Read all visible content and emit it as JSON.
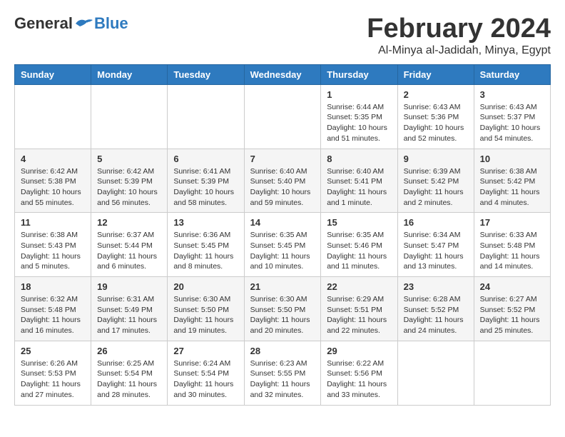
{
  "logo": {
    "general": "General",
    "blue": "Blue"
  },
  "header": {
    "month": "February 2024",
    "location": "Al-Minya al-Jadidah, Minya, Egypt"
  },
  "weekdays": [
    "Sunday",
    "Monday",
    "Tuesday",
    "Wednesday",
    "Thursday",
    "Friday",
    "Saturday"
  ],
  "weeks": [
    [
      {
        "day": "",
        "info": ""
      },
      {
        "day": "",
        "info": ""
      },
      {
        "day": "",
        "info": ""
      },
      {
        "day": "",
        "info": ""
      },
      {
        "day": "1",
        "info": "Sunrise: 6:44 AM\nSunset: 5:35 PM\nDaylight: 10 hours\nand 51 minutes."
      },
      {
        "day": "2",
        "info": "Sunrise: 6:43 AM\nSunset: 5:36 PM\nDaylight: 10 hours\nand 52 minutes."
      },
      {
        "day": "3",
        "info": "Sunrise: 6:43 AM\nSunset: 5:37 PM\nDaylight: 10 hours\nand 54 minutes."
      }
    ],
    [
      {
        "day": "4",
        "info": "Sunrise: 6:42 AM\nSunset: 5:38 PM\nDaylight: 10 hours\nand 55 minutes."
      },
      {
        "day": "5",
        "info": "Sunrise: 6:42 AM\nSunset: 5:39 PM\nDaylight: 10 hours\nand 56 minutes."
      },
      {
        "day": "6",
        "info": "Sunrise: 6:41 AM\nSunset: 5:39 PM\nDaylight: 10 hours\nand 58 minutes."
      },
      {
        "day": "7",
        "info": "Sunrise: 6:40 AM\nSunset: 5:40 PM\nDaylight: 10 hours\nand 59 minutes."
      },
      {
        "day": "8",
        "info": "Sunrise: 6:40 AM\nSunset: 5:41 PM\nDaylight: 11 hours\nand 1 minute."
      },
      {
        "day": "9",
        "info": "Sunrise: 6:39 AM\nSunset: 5:42 PM\nDaylight: 11 hours\nand 2 minutes."
      },
      {
        "day": "10",
        "info": "Sunrise: 6:38 AM\nSunset: 5:42 PM\nDaylight: 11 hours\nand 4 minutes."
      }
    ],
    [
      {
        "day": "11",
        "info": "Sunrise: 6:38 AM\nSunset: 5:43 PM\nDaylight: 11 hours\nand 5 minutes."
      },
      {
        "day": "12",
        "info": "Sunrise: 6:37 AM\nSunset: 5:44 PM\nDaylight: 11 hours\nand 6 minutes."
      },
      {
        "day": "13",
        "info": "Sunrise: 6:36 AM\nSunset: 5:45 PM\nDaylight: 11 hours\nand 8 minutes."
      },
      {
        "day": "14",
        "info": "Sunrise: 6:35 AM\nSunset: 5:45 PM\nDaylight: 11 hours\nand 10 minutes."
      },
      {
        "day": "15",
        "info": "Sunrise: 6:35 AM\nSunset: 5:46 PM\nDaylight: 11 hours\nand 11 minutes."
      },
      {
        "day": "16",
        "info": "Sunrise: 6:34 AM\nSunset: 5:47 PM\nDaylight: 11 hours\nand 13 minutes."
      },
      {
        "day": "17",
        "info": "Sunrise: 6:33 AM\nSunset: 5:48 PM\nDaylight: 11 hours\nand 14 minutes."
      }
    ],
    [
      {
        "day": "18",
        "info": "Sunrise: 6:32 AM\nSunset: 5:48 PM\nDaylight: 11 hours\nand 16 minutes."
      },
      {
        "day": "19",
        "info": "Sunrise: 6:31 AM\nSunset: 5:49 PM\nDaylight: 11 hours\nand 17 minutes."
      },
      {
        "day": "20",
        "info": "Sunrise: 6:30 AM\nSunset: 5:50 PM\nDaylight: 11 hours\nand 19 minutes."
      },
      {
        "day": "21",
        "info": "Sunrise: 6:30 AM\nSunset: 5:50 PM\nDaylight: 11 hours\nand 20 minutes."
      },
      {
        "day": "22",
        "info": "Sunrise: 6:29 AM\nSunset: 5:51 PM\nDaylight: 11 hours\nand 22 minutes."
      },
      {
        "day": "23",
        "info": "Sunrise: 6:28 AM\nSunset: 5:52 PM\nDaylight: 11 hours\nand 24 minutes."
      },
      {
        "day": "24",
        "info": "Sunrise: 6:27 AM\nSunset: 5:52 PM\nDaylight: 11 hours\nand 25 minutes."
      }
    ],
    [
      {
        "day": "25",
        "info": "Sunrise: 6:26 AM\nSunset: 5:53 PM\nDaylight: 11 hours\nand 27 minutes."
      },
      {
        "day": "26",
        "info": "Sunrise: 6:25 AM\nSunset: 5:54 PM\nDaylight: 11 hours\nand 28 minutes."
      },
      {
        "day": "27",
        "info": "Sunrise: 6:24 AM\nSunset: 5:54 PM\nDaylight: 11 hours\nand 30 minutes."
      },
      {
        "day": "28",
        "info": "Sunrise: 6:23 AM\nSunset: 5:55 PM\nDaylight: 11 hours\nand 32 minutes."
      },
      {
        "day": "29",
        "info": "Sunrise: 6:22 AM\nSunset: 5:56 PM\nDaylight: 11 hours\nand 33 minutes."
      },
      {
        "day": "",
        "info": ""
      },
      {
        "day": "",
        "info": ""
      }
    ]
  ]
}
